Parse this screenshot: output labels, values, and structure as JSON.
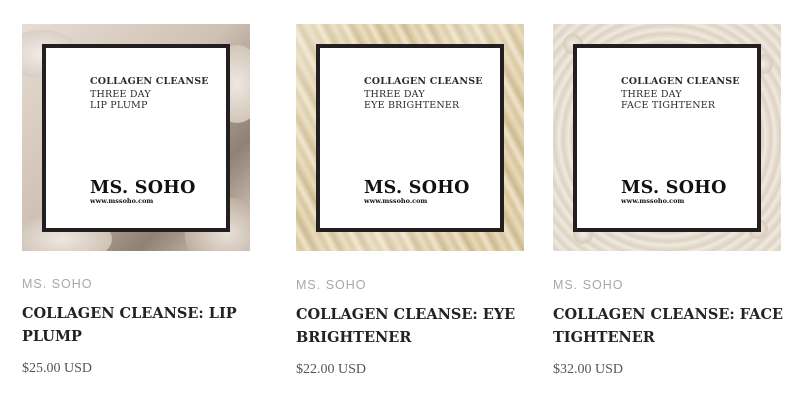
{
  "products": [
    {
      "image": {
        "line1": "COLLAGEN CLEANSE",
        "line2": "THREE DAY",
        "line3": "LIP PLUMP",
        "brand": "MS. SOHO",
        "url": "www.mssoho.com"
      },
      "vendor": "MS. SOHO",
      "title": "COLLAGEN CLEANSE: LIP PLUMP",
      "price": "$25.00 USD"
    },
    {
      "image": {
        "line1": "COLLAGEN CLEANSE",
        "line2": "THREE DAY",
        "line3": "EYE BRIGHTENER",
        "brand": "MS. SOHO",
        "url": "www.mssoho.com"
      },
      "vendor": "MS. SOHO",
      "title": "COLLAGEN CLEANSE: EYE BRIGHTENER",
      "price": "$22.00 USD"
    },
    {
      "image": {
        "line1": "COLLAGEN CLEANSE",
        "line2": "THREE DAY",
        "line3": "FACE TIGHTENER",
        "brand": "MS. SOHO",
        "url": "www.mssoho.com"
      },
      "vendor": "MS. SOHO",
      "title": "COLLAGEN CLEANSE: FACE TIGHTENER",
      "price": "$32.00 USD"
    }
  ]
}
